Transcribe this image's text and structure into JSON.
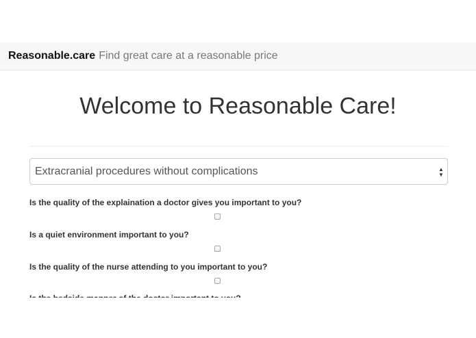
{
  "navbar": {
    "brand": "Reasonable.care",
    "tagline": "Find great care at a reasonable price"
  },
  "main": {
    "heading": "Welcome to Reasonable Care!",
    "procedure_select": {
      "selected": "Extracranial procedures without complications",
      "arrows_icon": "up-down-arrows-icon"
    },
    "questions": [
      {
        "label": "Is the quality of the explaination a doctor gives you important to you?",
        "checked": false
      },
      {
        "label": "Is a quiet environment important to you?",
        "checked": false
      },
      {
        "label": "Is the quality of the nurse attending to you important to you?",
        "checked": false
      },
      {
        "label": "Is the bedside manner of the doctor important to you?",
        "checked": false
      }
    ]
  }
}
